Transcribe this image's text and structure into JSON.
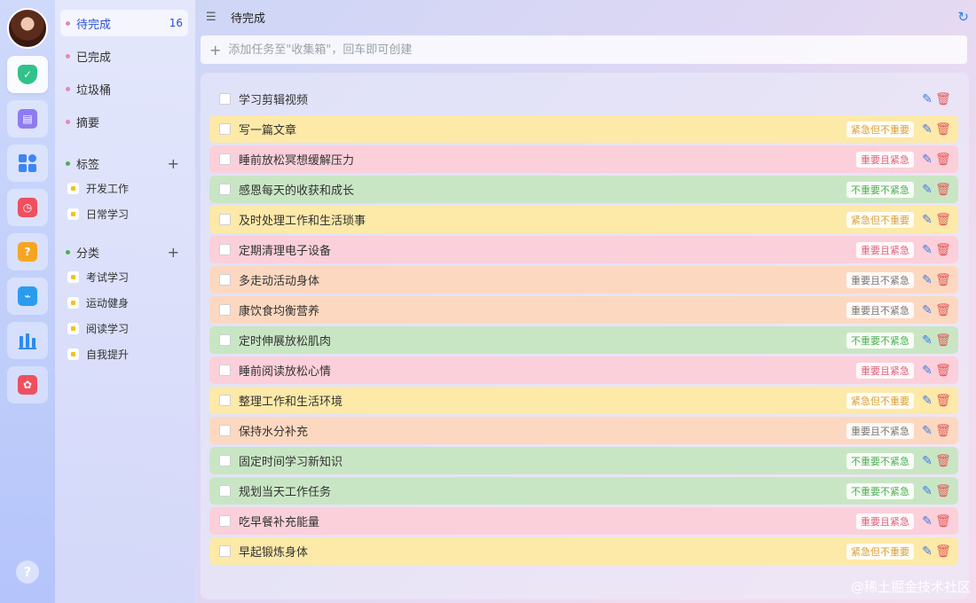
{
  "nav": {
    "items": [
      {
        "label": "待完成",
        "count": "16"
      },
      {
        "label": "已完成"
      },
      {
        "label": "垃圾桶"
      },
      {
        "label": "摘要"
      }
    ],
    "tags_title": "标签",
    "tags": [
      "开发工作",
      "日常学习"
    ],
    "categories_title": "分类",
    "categories": [
      "考试学习",
      "运动健身",
      "阅读学习",
      "自我提升"
    ]
  },
  "header": {
    "title": "待完成"
  },
  "add_task": {
    "placeholder": "添加任务至\"收集箱\"，回车即可创建"
  },
  "colors": {
    "urgent_not_important": "#fde9a8",
    "important_and_urgent": "#fbd0da",
    "not_important_not_urgent": "#c9e6c4",
    "important_not_urgent": "#fdd8c0",
    "none": "transparent"
  },
  "badge_colors": {
    "紧急但不重要": "#d9a03a",
    "重要且紧急": "#e0607a",
    "不重要不紧急": "#4caf50",
    "重要且不紧急": "#777777"
  },
  "tasks": [
    {
      "title": "学习剪辑视频",
      "priority": "",
      "color": "none"
    },
    {
      "title": "写一篇文章",
      "priority": "紧急但不重要",
      "color": "urgent_not_important"
    },
    {
      "title": "睡前放松冥想缓解压力",
      "priority": "重要且紧急",
      "color": "important_and_urgent"
    },
    {
      "title": "感恩每天的收获和成长",
      "priority": "不重要不紧急",
      "color": "not_important_not_urgent"
    },
    {
      "title": "及时处理工作和生活琐事",
      "priority": "紧急但不重要",
      "color": "urgent_not_important"
    },
    {
      "title": "定期清理电子设备",
      "priority": "重要且紧急",
      "color": "important_and_urgent"
    },
    {
      "title": "多走动活动身体",
      "priority": "重要且不紧急",
      "color": "important_not_urgent"
    },
    {
      "title": "康饮食均衡营养",
      "priority": "重要且不紧急",
      "color": "important_not_urgent"
    },
    {
      "title": "定时伸展放松肌肉",
      "priority": "不重要不紧急",
      "color": "not_important_not_urgent"
    },
    {
      "title": "睡前阅读放松心情",
      "priority": "重要且紧急",
      "color": "important_and_urgent"
    },
    {
      "title": "整理工作和生活环境",
      "priority": "紧急但不重要",
      "color": "urgent_not_important"
    },
    {
      "title": "保持水分补充",
      "priority": "重要且不紧急",
      "color": "important_not_urgent"
    },
    {
      "title": "固定时间学习新知识",
      "priority": "不重要不紧急",
      "color": "not_important_not_urgent"
    },
    {
      "title": "规划当天工作任务",
      "priority": "不重要不紧急",
      "color": "not_important_not_urgent"
    },
    {
      "title": "吃早餐补充能量",
      "priority": "重要且紧急",
      "color": "important_and_urgent"
    },
    {
      "title": "早起锻炼身体",
      "priority": "紧急但不重要",
      "color": "urgent_not_important"
    }
  ],
  "rail_icons": [
    "shield-check-icon",
    "calendar-icon",
    "apps-grid-icon",
    "calendar-clock-icon",
    "question-chat-icon",
    "monitor-chart-icon",
    "bar-chart-icon",
    "flower-app-icon"
  ],
  "help_label": "?",
  "watermark": "@稀土掘金技术社区"
}
